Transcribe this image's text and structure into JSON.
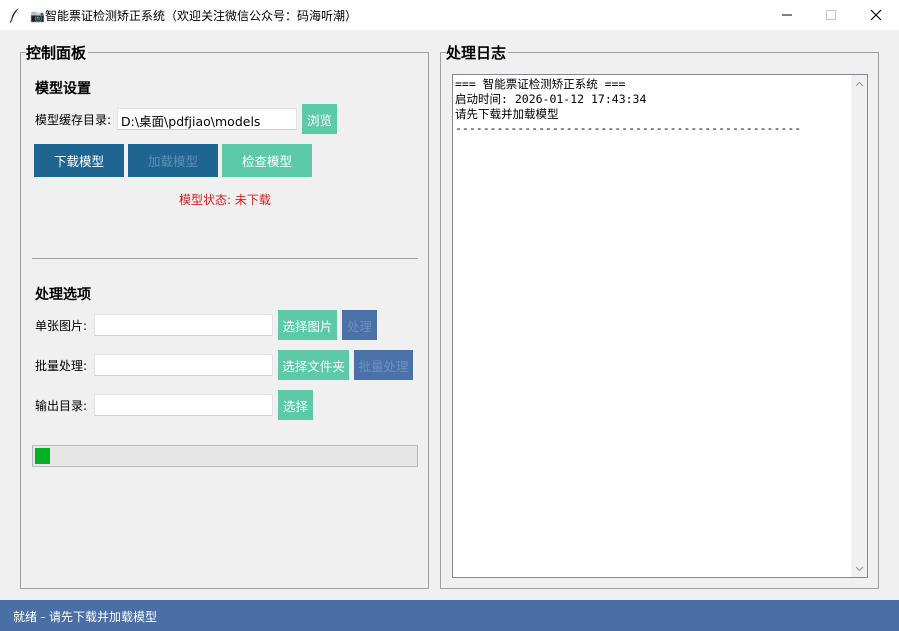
{
  "window": {
    "title": "📷智能票证检测矫正系统（欢迎关注微信公众号：码海听潮）"
  },
  "control_panel": {
    "title": "控制面板",
    "model_settings": {
      "title": "模型设置",
      "cache_dir_label": "模型缓存目录:",
      "cache_dir_value": "D:\\桌面\\pdfjiao\\models",
      "browse_label": "浏览",
      "download_label": "下载模型",
      "load_label": "加载模型",
      "check_label": "检查模型",
      "status_text": "模型状态: 未下载"
    },
    "processing": {
      "title": "处理选项",
      "single_label": "单张图片:",
      "single_value": "",
      "select_image_label": "选择图片",
      "process_label": "处理",
      "batch_label": "批量处理:",
      "batch_value": "",
      "select_folder_label": "选择文件夹",
      "batch_process_label": "批量处理",
      "output_label": "输出目录:",
      "output_value": "",
      "select_label": "选择"
    },
    "progress": 0.04
  },
  "log_panel": {
    "title": "处理日志",
    "text": "=== 智能票证检测矫正系统 ===\n启动时间: 2026-01-12 17:43:34\n请先下载并加载模型\n--------------------------------------------------"
  },
  "status_bar": {
    "text": "就绪 - 请先下载并加载模型"
  },
  "colors": {
    "dark_button": "#1e6591",
    "green_button": "#5ccaa6",
    "blue_button": "#4a72a8",
    "status_bar": "#4a6fa5",
    "error_text": "#d42020",
    "progress": "#06b025"
  }
}
